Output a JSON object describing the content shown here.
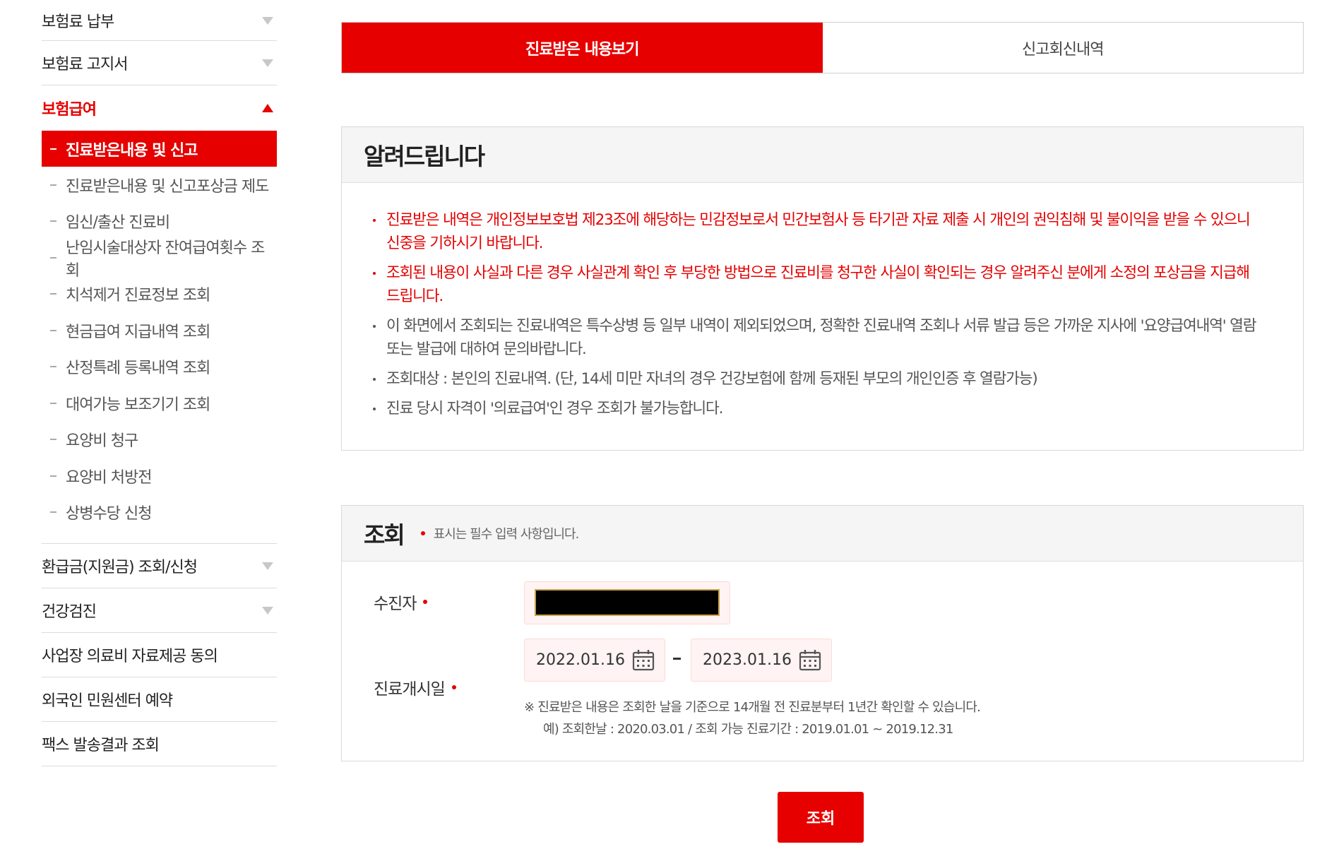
{
  "sidebar": {
    "top_items": [
      {
        "label": "보험료 납부"
      },
      {
        "label": "보험료 고지서"
      }
    ],
    "active_group": {
      "label": "보험급여"
    },
    "sub_items": [
      {
        "label": "진료받은내용 및 신고"
      },
      {
        "label": "진료받은내용 및 신고포상금 제도"
      },
      {
        "label": "임신/출산 진료비"
      },
      {
        "label": "난임시술대상자 잔여급여횟수 조회"
      },
      {
        "label": "치석제거 진료정보 조회"
      },
      {
        "label": "현금급여 지급내역 조회"
      },
      {
        "label": "산정특례 등록내역 조회"
      },
      {
        "label": "대여가능 보조기기 조회"
      },
      {
        "label": "요양비 청구"
      },
      {
        "label": "요양비 처방전"
      },
      {
        "label": "상병수당 신청"
      }
    ],
    "bottom_items": [
      {
        "label": "환급금(지원금) 조회/신청"
      },
      {
        "label": "건강검진"
      },
      {
        "label": "사업장 의료비 자료제공 동의"
      },
      {
        "label": "외국인 민원센터 예약"
      },
      {
        "label": "팩스 발송결과 조회"
      }
    ]
  },
  "tabs": [
    {
      "label": "진료받은 내용보기"
    },
    {
      "label": "신고회신내역"
    }
  ],
  "notice": {
    "title": "알려드립니다",
    "items": [
      {
        "text": "진료받은 내역은 개인정보보호법 제23조에 해당하는 민감정보로서 민간보험사 등 타기관 자료 제출 시 개인의 권익침해 및 불이익을 받을 수 있으니 신중을 기하시기 바랍니다."
      },
      {
        "text": "조회된 내용이 사실과 다른 경우 사실관계 확인 후 부당한 방법으로 진료비를 청구한 사실이 확인되는 경우 알려주신 분에게 소정의 포상금을 지급해 드립니다."
      },
      {
        "text": "이 화면에서 조회되는 진료내역은 특수상병 등 일부 내역이 제외되었으며, 정확한 진료내역 조회나 서류 발급 등은 가까운 지사에 '요양급여내역' 열람 또는 발급에 대하여 문의바랍니다."
      },
      {
        "text": "조회대상 : 본인의 진료내역. (단, 14세 미만 자녀의 경우 건강보험에 함께 등재된 부모의 개인인증 후 열람가능)"
      },
      {
        "text": "진료 당시 자격이 '의료급여'인 경우 조회가 불가능합니다."
      }
    ]
  },
  "search": {
    "title": "조회",
    "required_note": "표시는 필수 입력 사항입니다.",
    "patient_label": "수진자",
    "date_label": "진료개시일",
    "start_date": "2022.01.16",
    "end_date": "2023.01.16",
    "hint_line1": "※ 진료받은 내용은 조회한 날을 기준으로 14개월 전 진료분부터 1년간 확인할 수 있습니다.",
    "hint_line2": "예) 조회한날 : 2020.03.01 / 조회 가능 진료기간 : 2019.01.01 ~ 2019.12.31"
  },
  "submit_label": "조회",
  "colors": {
    "accent": "#e60000",
    "input_bg": "#fff3f3"
  }
}
